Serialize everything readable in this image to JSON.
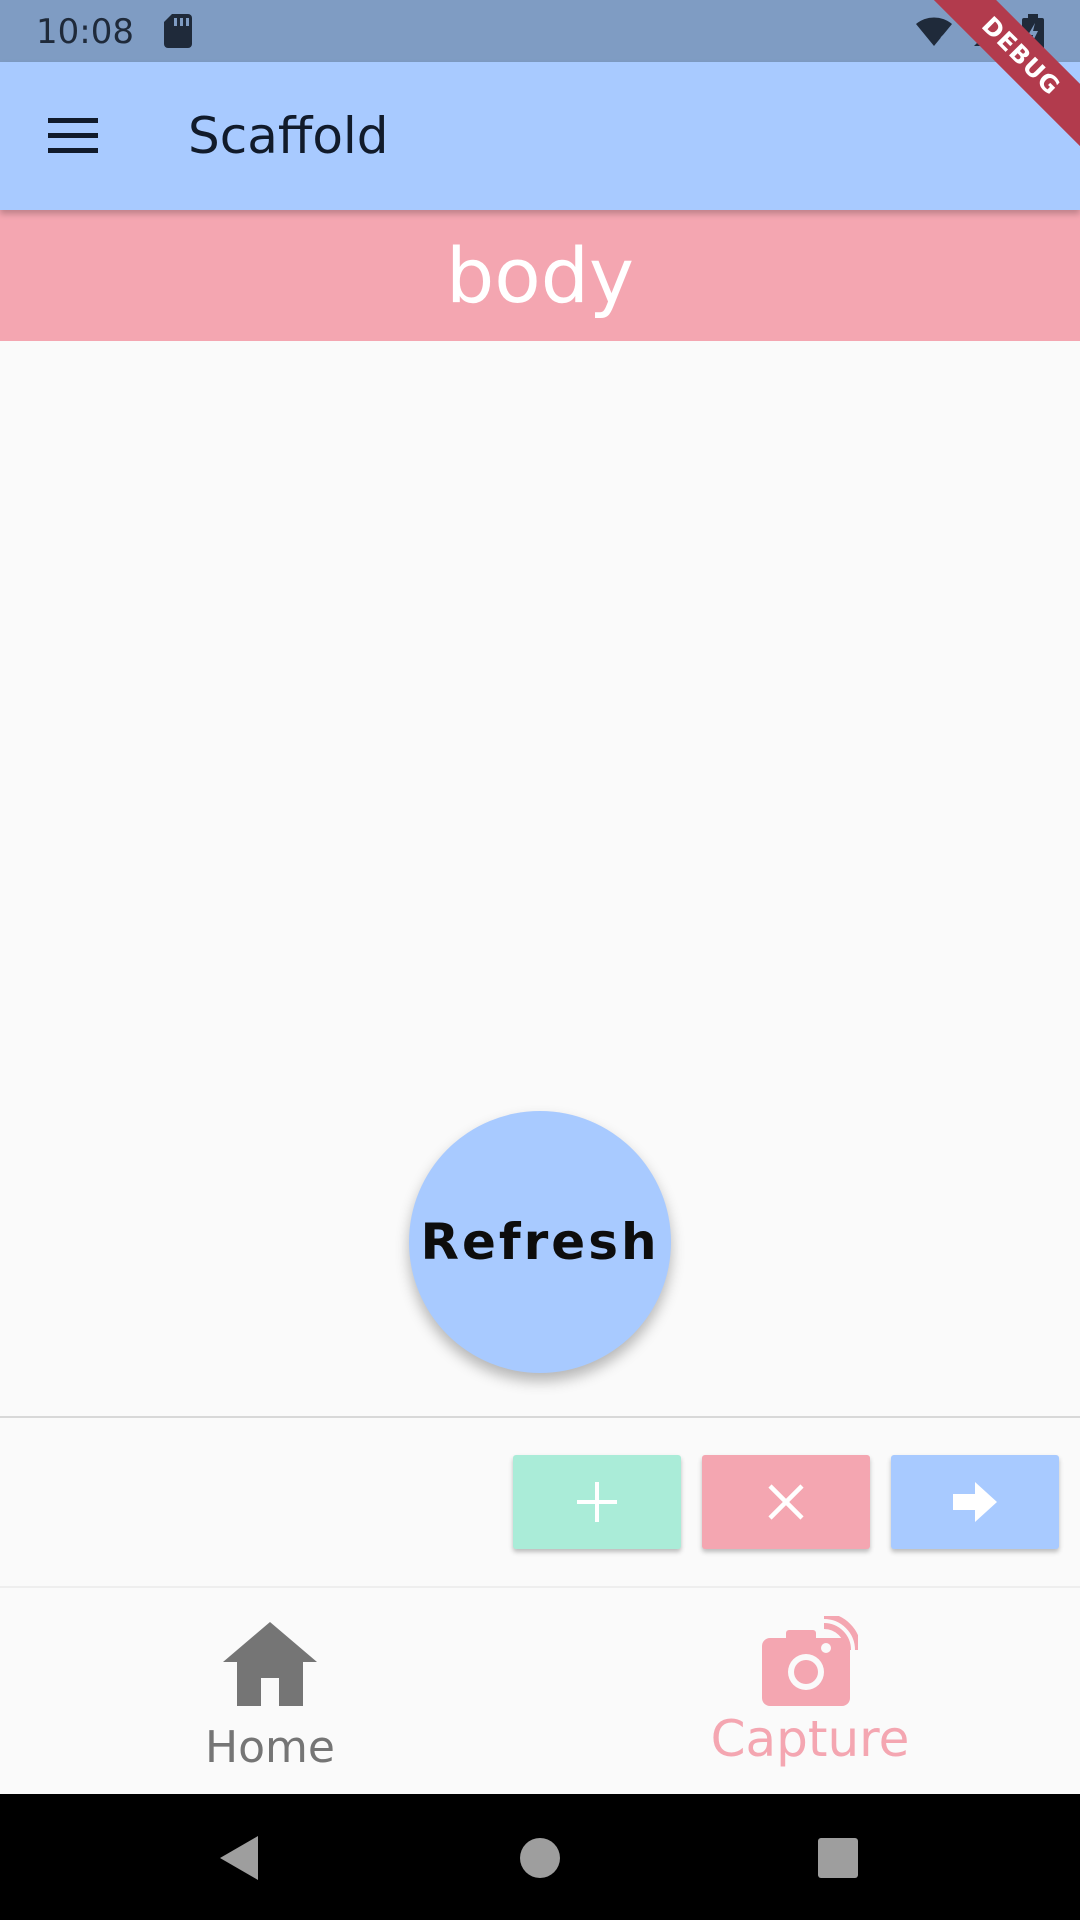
{
  "status_bar": {
    "time": "10:08",
    "icons": [
      "sd-card-icon",
      "wifi-off-icon",
      "signal-icon",
      "battery-charging-icon"
    ]
  },
  "debug_banner": {
    "label": "DEBUG"
  },
  "app_bar": {
    "title": "Scaffold",
    "menu_icon": "menu-icon",
    "color": "#a8caff"
  },
  "body_banner": {
    "label": "body",
    "color": "#f4a6b1"
  },
  "fab": {
    "label": "Refresh",
    "color": "#a8caff"
  },
  "footer_buttons": [
    {
      "icon": "plus-icon",
      "color": "#aaecd8"
    },
    {
      "icon": "close-icon",
      "color": "#f4a6b1"
    },
    {
      "icon": "arrow-right-icon",
      "color": "#a8caff"
    }
  ],
  "bottom_nav": {
    "items": [
      {
        "label": "Home",
        "icon": "home-icon",
        "selected": false
      },
      {
        "label": "Capture",
        "icon": "camera-icon",
        "selected": true
      }
    ],
    "selected_color": "#f4a6b1",
    "unselected_color": "#757575"
  },
  "system_nav": {
    "icons": [
      "back-icon",
      "home-circle-icon",
      "recents-icon"
    ]
  }
}
